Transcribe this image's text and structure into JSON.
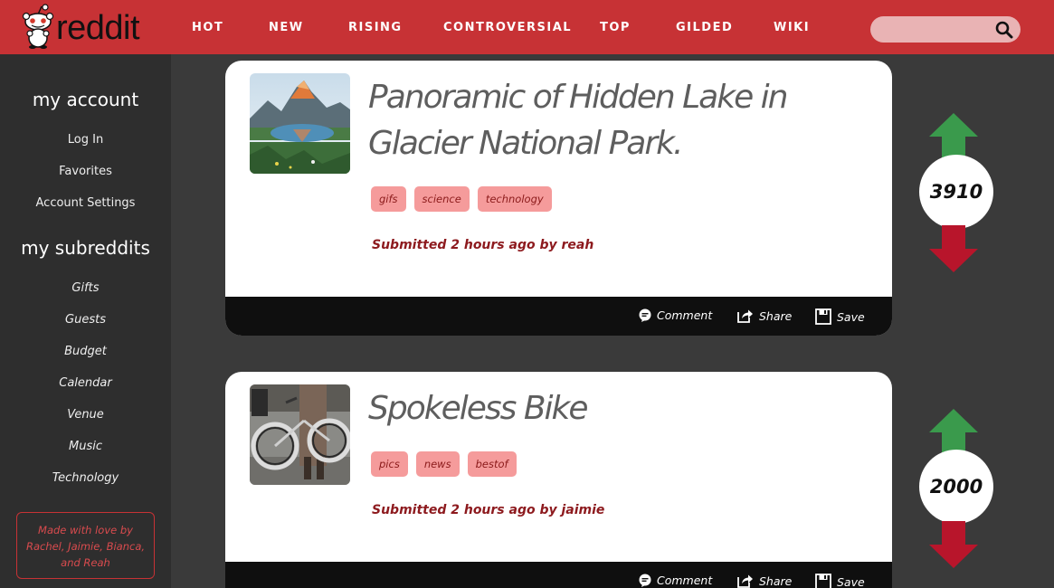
{
  "header": {
    "logo_text": "reddit",
    "nav": [
      "HOT",
      "NEW",
      "RISING",
      "CONTROVERSIAL",
      "TOP",
      "GILDED",
      "WIKI"
    ],
    "search_placeholder": ""
  },
  "sidebar": {
    "account_heading": "my account",
    "account_links": [
      "Log In",
      "Favorites",
      "Account Settings"
    ],
    "subreddits_heading": "my subreddits",
    "subreddits": [
      "Gifts",
      "Guests",
      "Budget",
      "Calendar",
      "Venue",
      "Music",
      "Technology"
    ],
    "credits_lines": [
      "Made with love by",
      "Rachel, Jaimie, Bianca,",
      "and Reah"
    ]
  },
  "posts": [
    {
      "title_lines": [
        "Panoramic of Hidden Lake in",
        "Glacier National Park."
      ],
      "tags": [
        "gifs",
        "science",
        "technology"
      ],
      "submitted": "Submitted 2 hours ago by reah",
      "score": "3910",
      "thumb_icon": "mountain-lake-photo"
    },
    {
      "title_lines": [
        "Spokeless Bike"
      ],
      "tags": [
        "pics",
        "news",
        "bestof"
      ],
      "submitted": "Submitted 2 hours ago by jaimie",
      "score": "2000",
      "thumb_icon": "bike-photo"
    }
  ],
  "actions": {
    "comment": "Comment",
    "share": "Share",
    "save": "Save"
  },
  "colors": {
    "brand_red": "#c73235",
    "upvote_green": "#3a9a4c",
    "downvote_red": "#b8152b",
    "tag_bg": "#f59b9b"
  }
}
